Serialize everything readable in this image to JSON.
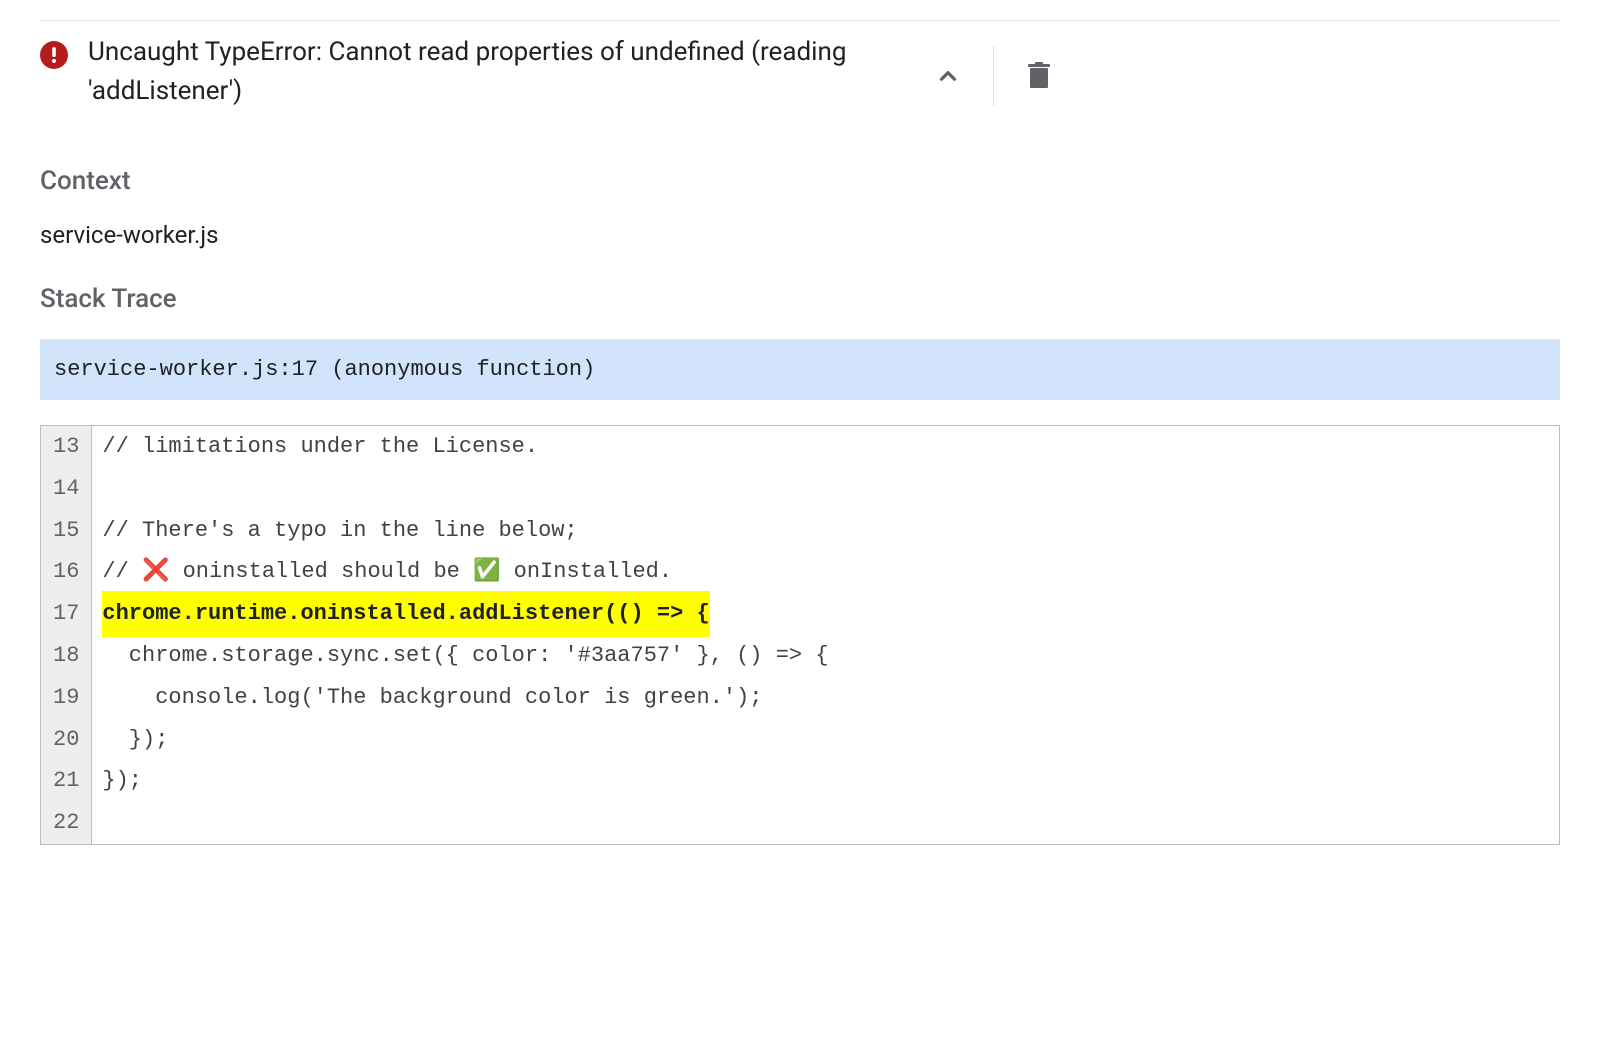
{
  "error": {
    "title": "Uncaught TypeError: Cannot read properties of undefined (reading 'addListener')"
  },
  "context": {
    "heading": "Context",
    "value": "service-worker.js"
  },
  "stack": {
    "heading": "Stack Trace",
    "frame": "service-worker.js:17 (anonymous function)"
  },
  "code": {
    "lines": [
      {
        "num": "13",
        "text": "// limitations under the License.",
        "highlight": false
      },
      {
        "num": "14",
        "text": "",
        "highlight": false
      },
      {
        "num": "15",
        "text": "// There's a typo in the line below;",
        "highlight": false
      },
      {
        "num": "16",
        "text": "// ❌ oninstalled should be ✅ onInstalled.",
        "highlight": false
      },
      {
        "num": "17",
        "text": "chrome.runtime.oninstalled.addListener(() => {",
        "highlight": true
      },
      {
        "num": "18",
        "text": "  chrome.storage.sync.set({ color: '#3aa757' }, () => {",
        "highlight": false
      },
      {
        "num": "19",
        "text": "    console.log('The background color is green.');",
        "highlight": false
      },
      {
        "num": "20",
        "text": "  });",
        "highlight": false
      },
      {
        "num": "21",
        "text": "});",
        "highlight": false
      },
      {
        "num": "22",
        "text": "",
        "highlight": false
      }
    ]
  }
}
